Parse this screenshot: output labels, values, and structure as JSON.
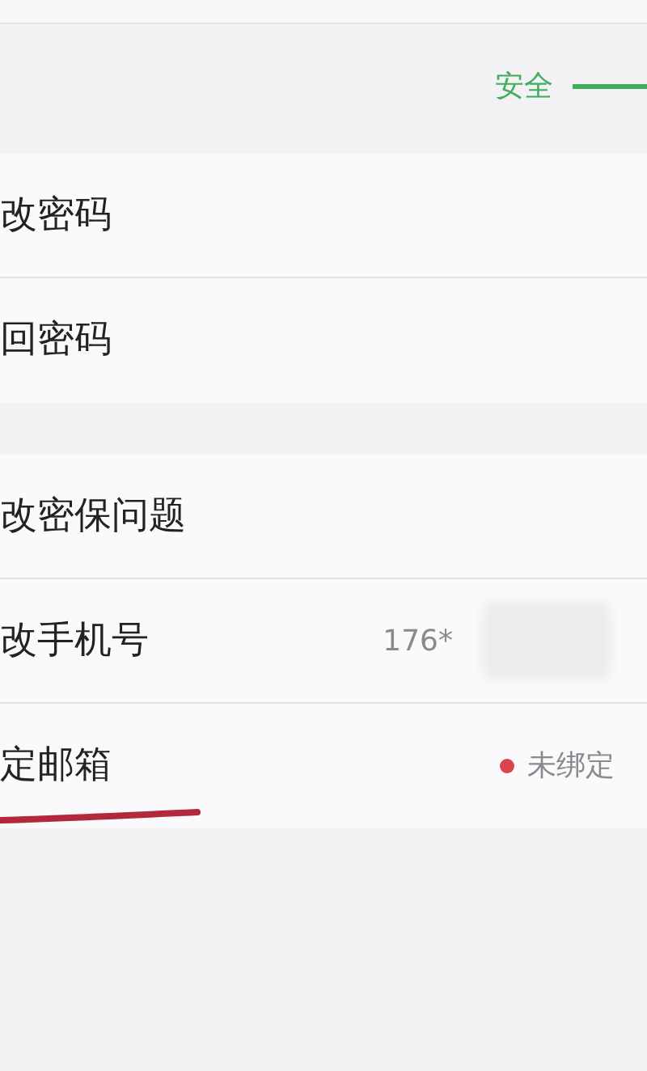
{
  "security_label": "安全",
  "groups": [
    {
      "rows": [
        {
          "label": "改密码"
        },
        {
          "label": "回密码"
        }
      ]
    },
    {
      "rows": [
        {
          "label": "改密保问题"
        },
        {
          "label": "改手机号",
          "value": "176*",
          "redacted": true
        },
        {
          "label": "定邮箱",
          "status": "未绑定",
          "underlined": true
        }
      ]
    }
  ]
}
